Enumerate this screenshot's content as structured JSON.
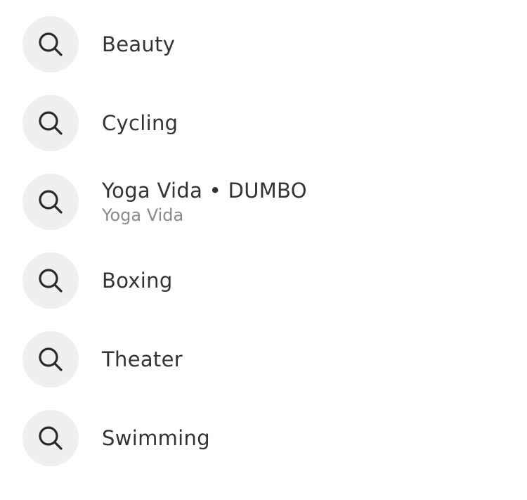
{
  "suggestions": [
    {
      "title": "Beauty",
      "subtitle": "",
      "icon": "search-icon"
    },
    {
      "title": "Cycling",
      "subtitle": "",
      "icon": "search-icon"
    },
    {
      "title": "Yoga Vida • DUMBO",
      "subtitle": "Yoga Vida",
      "icon": "search-icon"
    },
    {
      "title": "Boxing",
      "subtitle": "",
      "icon": "search-icon"
    },
    {
      "title": "Theater",
      "subtitle": "",
      "icon": "search-icon"
    },
    {
      "title": "Swimming",
      "subtitle": "",
      "icon": "search-icon"
    }
  ],
  "colors": {
    "icon_background": "#efefef",
    "title_text": "#333333",
    "subtitle_text": "#8a8a8a"
  }
}
